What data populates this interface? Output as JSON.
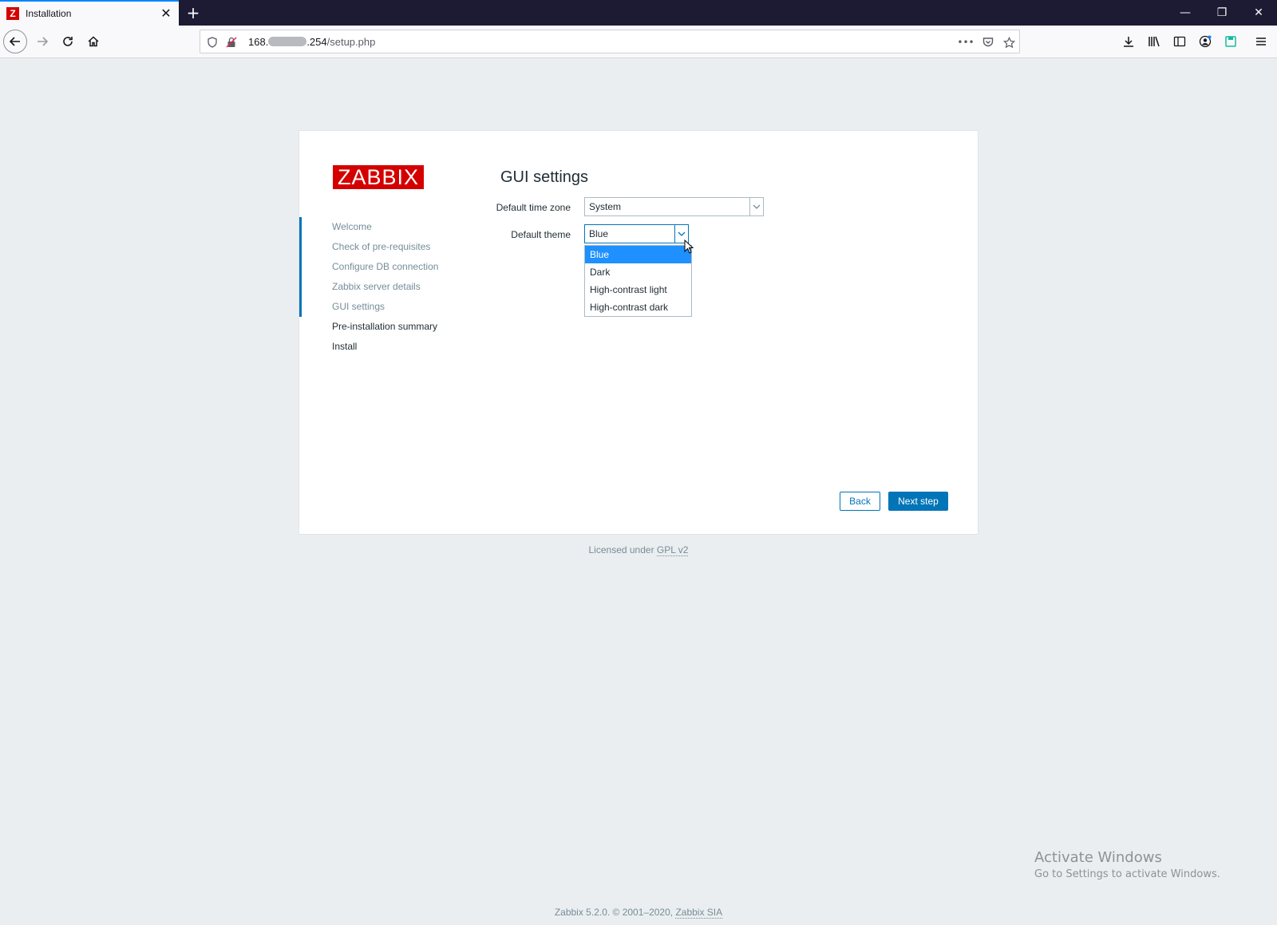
{
  "browser": {
    "tab_title": "Installation",
    "tab_favicon_letter": "Z",
    "url_prefix": "168.",
    "url_host_tail": ".254",
    "url_path": "/setup.php"
  },
  "setup": {
    "logo": "ZABBIX",
    "title": "GUI settings",
    "steps": [
      {
        "label": "Welcome",
        "state": "done"
      },
      {
        "label": "Check of pre-requisites",
        "state": "done"
      },
      {
        "label": "Configure DB connection",
        "state": "done"
      },
      {
        "label": "Zabbix server details",
        "state": "done"
      },
      {
        "label": "GUI settings",
        "state": "done"
      },
      {
        "label": "Pre-installation summary",
        "state": "todo"
      },
      {
        "label": "Install",
        "state": "todo"
      }
    ],
    "timezone_label": "Default time zone",
    "timezone_value": "System",
    "theme_label": "Default theme",
    "theme_value": "Blue",
    "theme_options": [
      "Blue",
      "Dark",
      "High-contrast light",
      "High-contrast dark"
    ],
    "back_label": "Back",
    "next_label": "Next step"
  },
  "license": {
    "prefix": "Licensed under ",
    "link": "GPL v2"
  },
  "footer": {
    "text": "Zabbix 5.2.0. © 2001–2020, ",
    "link": "Zabbix SIA"
  },
  "watermark": {
    "title": "Activate Windows",
    "subtitle": "Go to Settings to activate Windows."
  },
  "colors": {
    "accent": "#0275b8",
    "brand": "#d40000",
    "selected_option": "#1e90ff"
  }
}
